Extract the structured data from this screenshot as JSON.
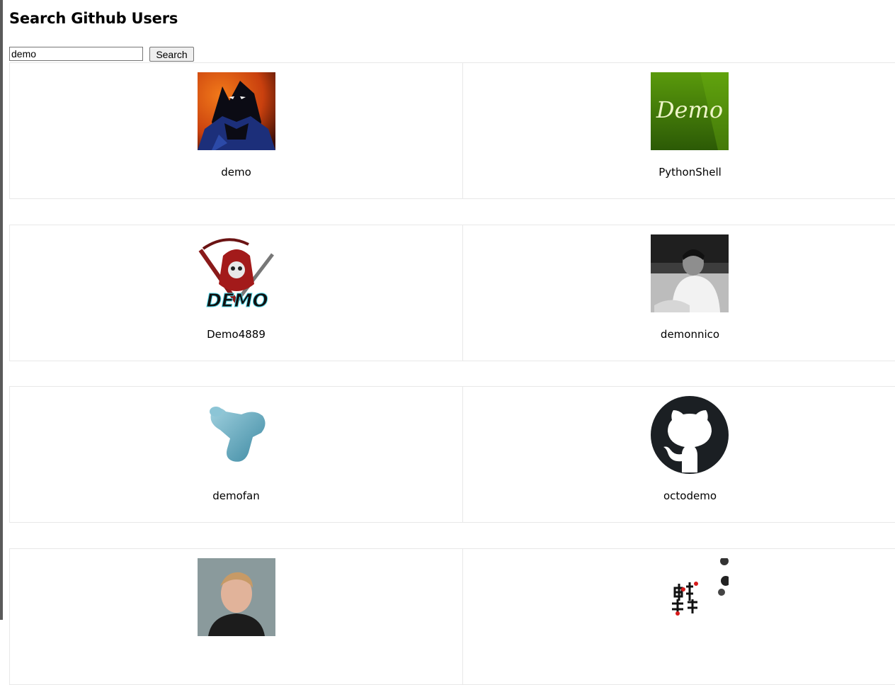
{
  "page": {
    "title": "Search Github Users"
  },
  "search": {
    "value": "demo",
    "button_label": "Search"
  },
  "users": [
    {
      "login": "demo",
      "avatar_icon": "batman-avatar"
    },
    {
      "login": "PythonShell",
      "avatar_icon": "demo-text-avatar"
    },
    {
      "login": "Demo4889",
      "avatar_icon": "reaper-logo-avatar"
    },
    {
      "login": "demonnico",
      "avatar_icon": "person-photo-avatar"
    },
    {
      "login": "demofan",
      "avatar_icon": "puzzle-shape-avatar"
    },
    {
      "login": "octodemo",
      "avatar_icon": "github-octocat-avatar"
    },
    {
      "login": "",
      "avatar_icon": "person-photo-avatar"
    },
    {
      "login": "",
      "avatar_icon": "chinese-calligraphy-avatar"
    }
  ]
}
